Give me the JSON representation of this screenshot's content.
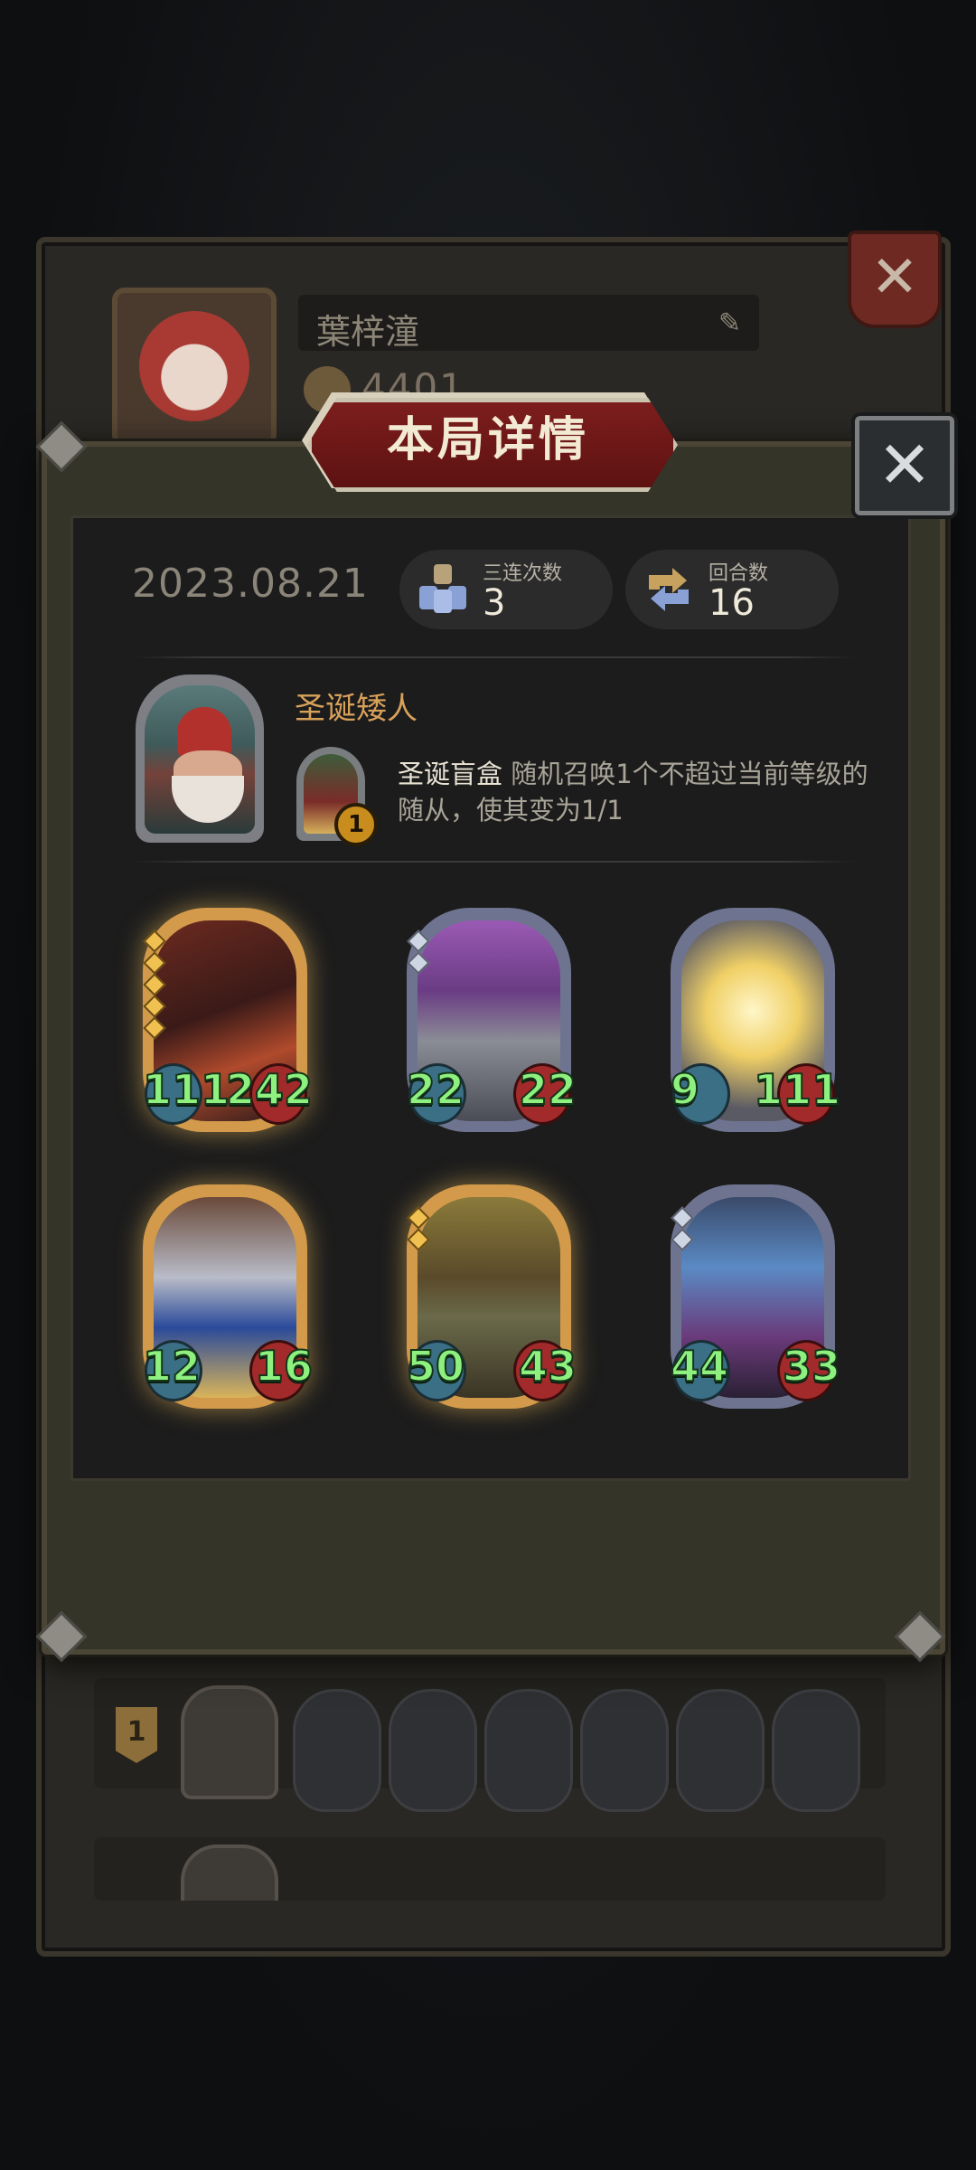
{
  "background_profile": {
    "player_name": "葉梓潼",
    "score": "4401",
    "history_rows": [
      {
        "rank": "1"
      }
    ]
  },
  "modal": {
    "title": "本局详情",
    "date": "2023.08.21",
    "stats": [
      {
        "label": "三连次数",
        "value": "3",
        "icon": "triple-blocks-icon"
      },
      {
        "label": "回合数",
        "value": "16",
        "icon": "turn-arrows-icon"
      }
    ],
    "hero": {
      "name": "圣诞矮人",
      "power": {
        "name": "圣诞盲盒",
        "cost": "1",
        "description": "随机召唤1个不超过当前等级的随从，使其变为1/1"
      }
    },
    "minions": [
      {
        "attack": "111",
        "health": "242",
        "frame": "gold",
        "tier": 5,
        "art": "rogue-assassin"
      },
      {
        "attack": "22",
        "health": "22",
        "frame": "silver",
        "tier": 2,
        "art": "robot-trashcan"
      },
      {
        "attack": "9",
        "health": "111",
        "frame": "silver",
        "tier": 0,
        "art": "old-engineer"
      },
      {
        "attack": "12",
        "health": "16",
        "frame": "gold",
        "tier": 0,
        "art": "armored-knight"
      },
      {
        "attack": "50",
        "health": "43",
        "frame": "gold",
        "tier": 2,
        "art": "hat-wizard"
      },
      {
        "attack": "44",
        "health": "33",
        "frame": "silver",
        "tier": 2,
        "art": "elf-sorceress"
      }
    ]
  },
  "colors": {
    "gold_frame": "#d29a4a",
    "silver_frame": "#6e7490",
    "stat_text": "#8ef07e",
    "title_banner": "#7d1d1d"
  }
}
